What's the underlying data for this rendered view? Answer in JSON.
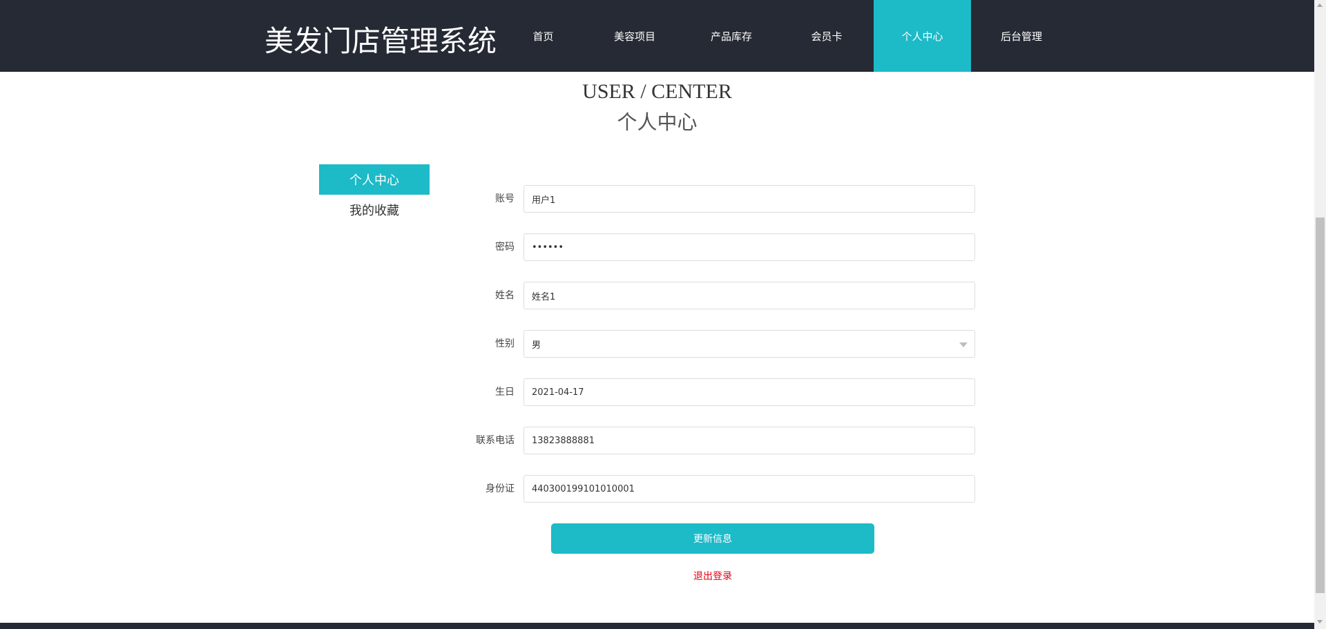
{
  "header": {
    "brand": "美发门店管理系统",
    "nav": [
      {
        "label": "首页",
        "active": false
      },
      {
        "label": "美容项目",
        "active": false
      },
      {
        "label": "产品库存",
        "active": false
      },
      {
        "label": "会员卡",
        "active": false
      },
      {
        "label": "个人中心",
        "active": true
      },
      {
        "label": "后台管理",
        "active": false
      }
    ]
  },
  "page": {
    "title_en": "USER / CENTER",
    "title_cn": "个人中心"
  },
  "sidebar": {
    "items": [
      {
        "label": "个人中心",
        "active": true
      },
      {
        "label": "我的收藏",
        "active": false
      }
    ]
  },
  "form": {
    "account": {
      "label": "账号",
      "value": "用户1"
    },
    "password": {
      "label": "密码",
      "value": "••••••"
    },
    "name": {
      "label": "姓名",
      "value": "姓名1"
    },
    "gender": {
      "label": "性别",
      "value": "男"
    },
    "birthday": {
      "label": "生日",
      "value": "2021-04-17"
    },
    "phone": {
      "label": "联系电话",
      "value": "13823888881"
    },
    "idcard": {
      "label": "身份证",
      "value": "440300199101010001"
    },
    "submit_label": "更新信息",
    "logout_label": "退出登录"
  },
  "colors": {
    "accent": "#1dbac8",
    "header_bg": "#252a34",
    "logout": "#e60012"
  },
  "icons": {
    "gender_dropdown": "chevron-down-icon"
  }
}
